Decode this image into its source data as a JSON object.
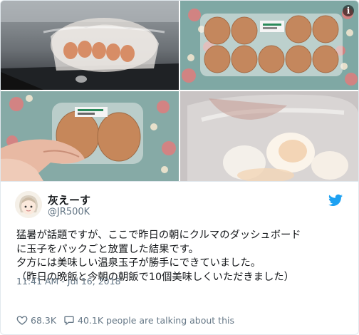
{
  "tweet": {
    "author_name": "灰えーす",
    "handle": "@JR500K",
    "text": "猛暑が話題ですが、ここで昨日の朝にクルマのダッシュボード\nに玉子をパックごと放置した結果です。\n夕方には美味しい温泉玉子が勝手にできていました。\n（昨日の晩飯と今朝の朝飯で10個美味しくいただきました）",
    "timestamp": "11:41 AM - Jul 16, 2018",
    "likes": "68.3K",
    "talking": "40.1K people are talking about this"
  },
  "icons": {
    "info": "info-icon",
    "bird": "twitter-bird-icon",
    "heart": "heart-icon",
    "reply": "speech-bubble-icon"
  },
  "colors": {
    "brand": "#1da1f2",
    "text": "#14171a",
    "muted": "#657786",
    "border": "#e1e8ed"
  }
}
